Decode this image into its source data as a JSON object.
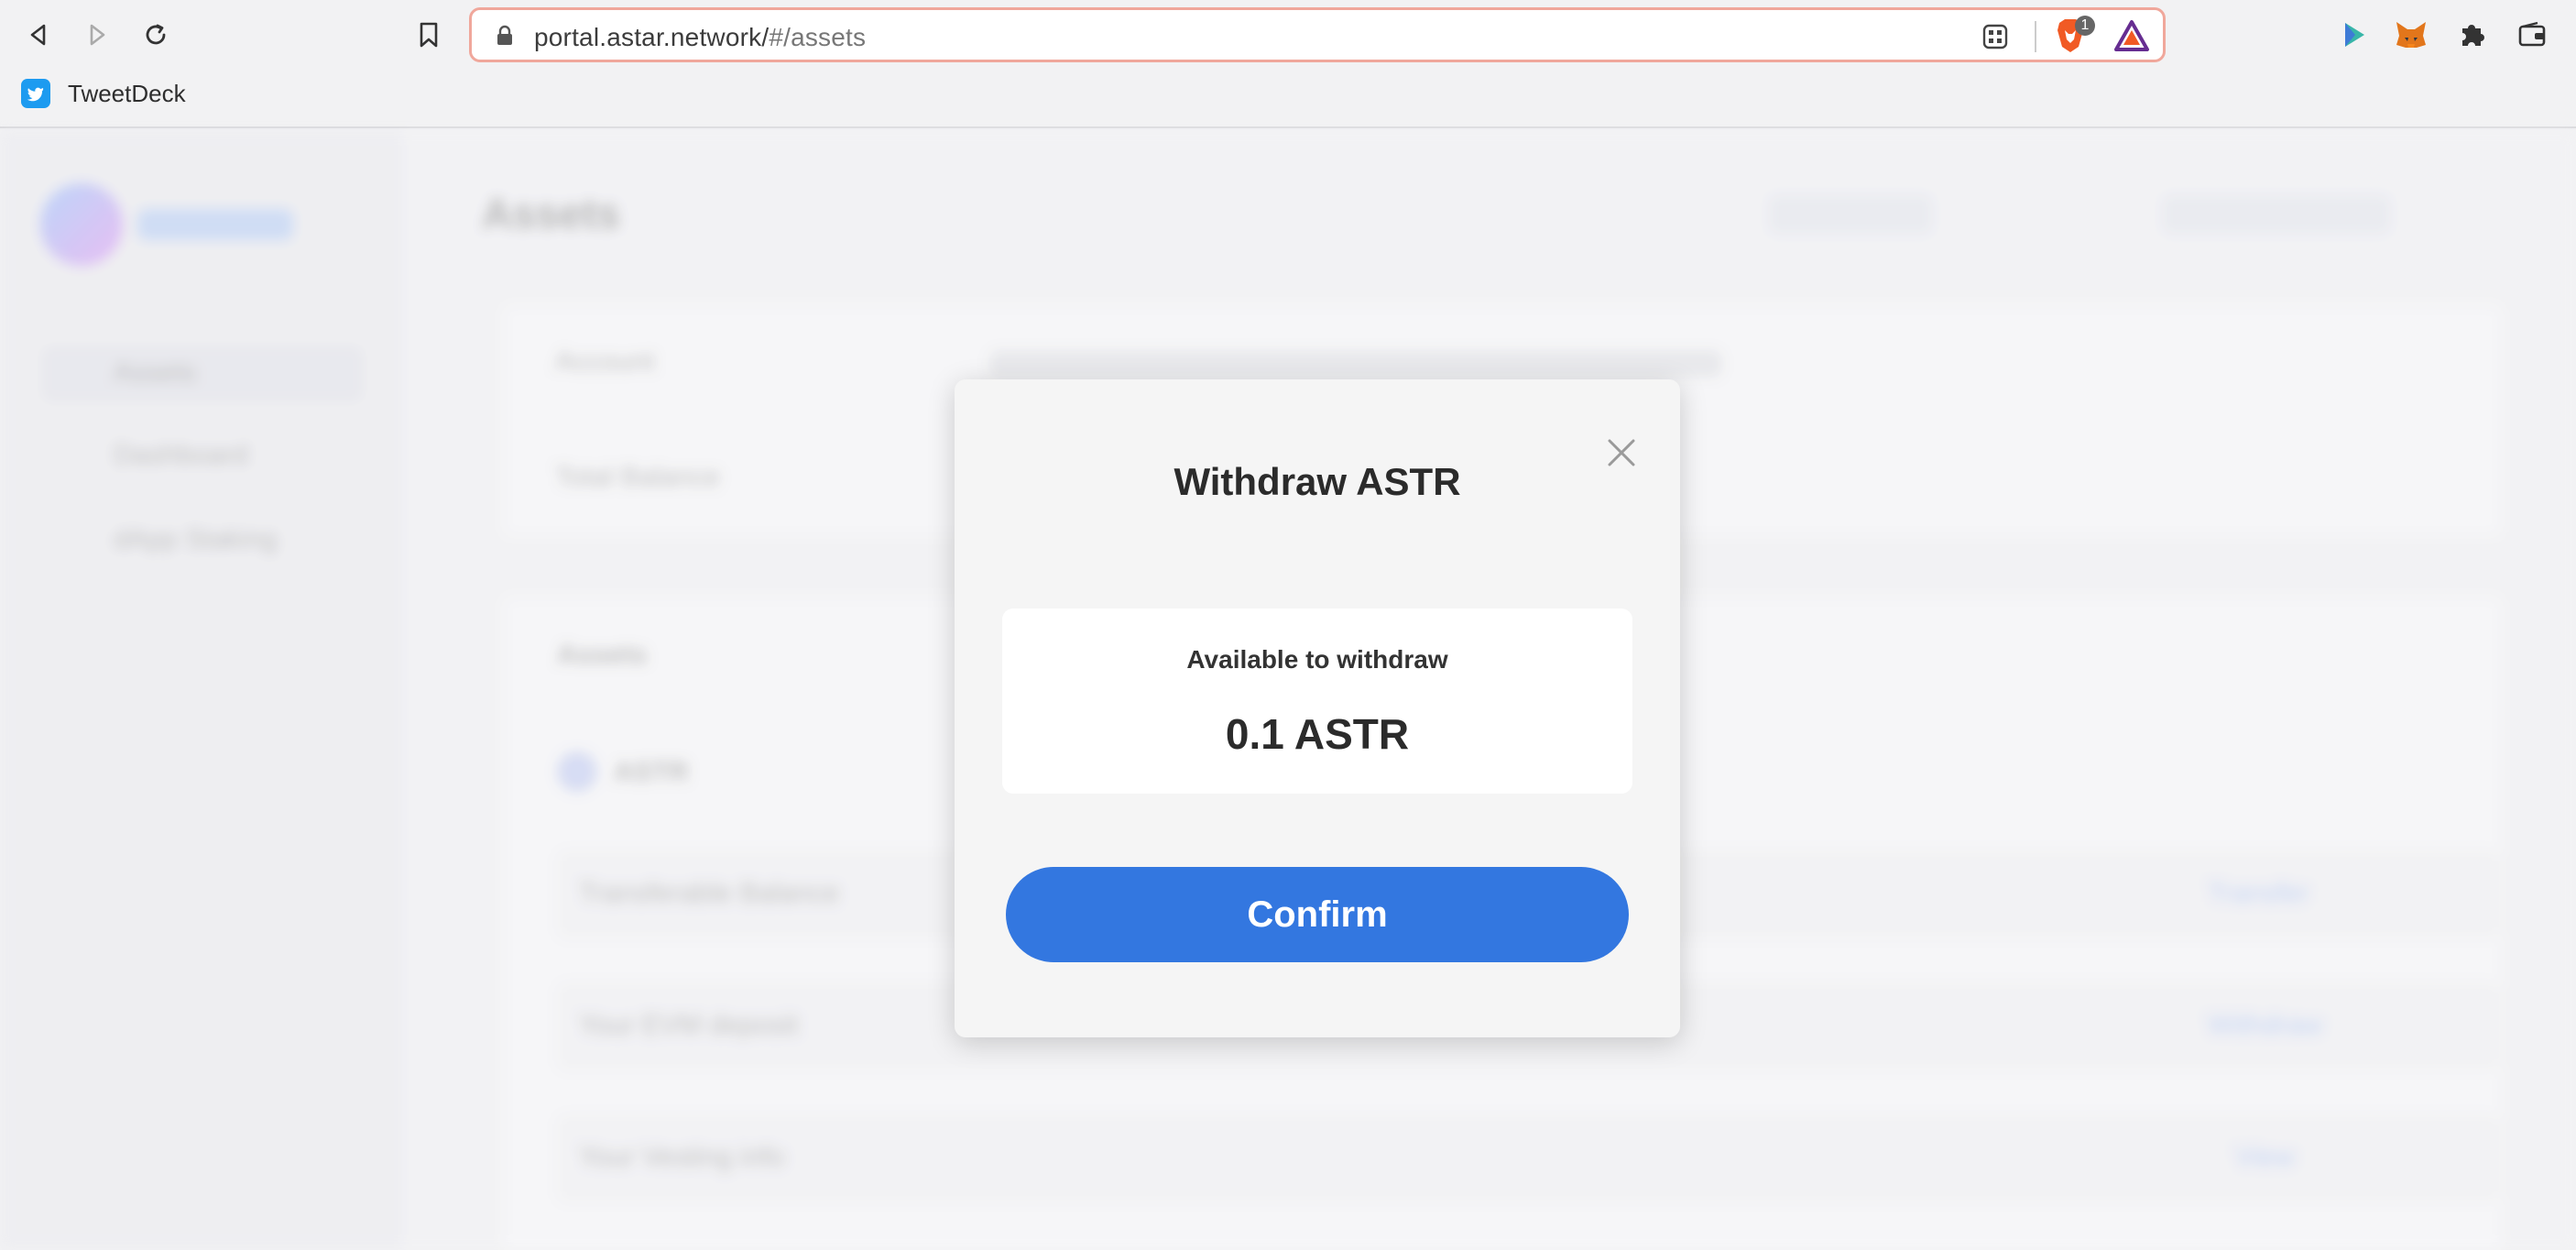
{
  "browser": {
    "url_host": "portal.astar.network/",
    "url_path": "#/assets",
    "shields_count": "1",
    "bookmarks": [
      {
        "label": "TweetDeck",
        "icon": "twitter-icon"
      }
    ]
  },
  "background_app": {
    "page_title": "Assets",
    "sidebar_items": [
      "Assets",
      "Dashboard",
      "dApp Staking"
    ],
    "account_label": "Account",
    "total_balance_label": "Total Balance",
    "assets_section_title": "Assets",
    "token": "ASTR",
    "rows": [
      {
        "label": "Transferable Balance",
        "action": "Transfer"
      },
      {
        "label": "Your EVM deposit",
        "action": "Withdraw"
      },
      {
        "label": "Your Vesting info",
        "action": "View"
      }
    ]
  },
  "modal": {
    "title": "Withdraw ASTR",
    "available_label": "Available to withdraw",
    "available_value": "0.1 ASTR",
    "confirm_label": "Confirm"
  },
  "colors": {
    "accent": "#3377e0",
    "urlbar_border": "#f0a79b",
    "brave_orange": "#f15a24"
  }
}
